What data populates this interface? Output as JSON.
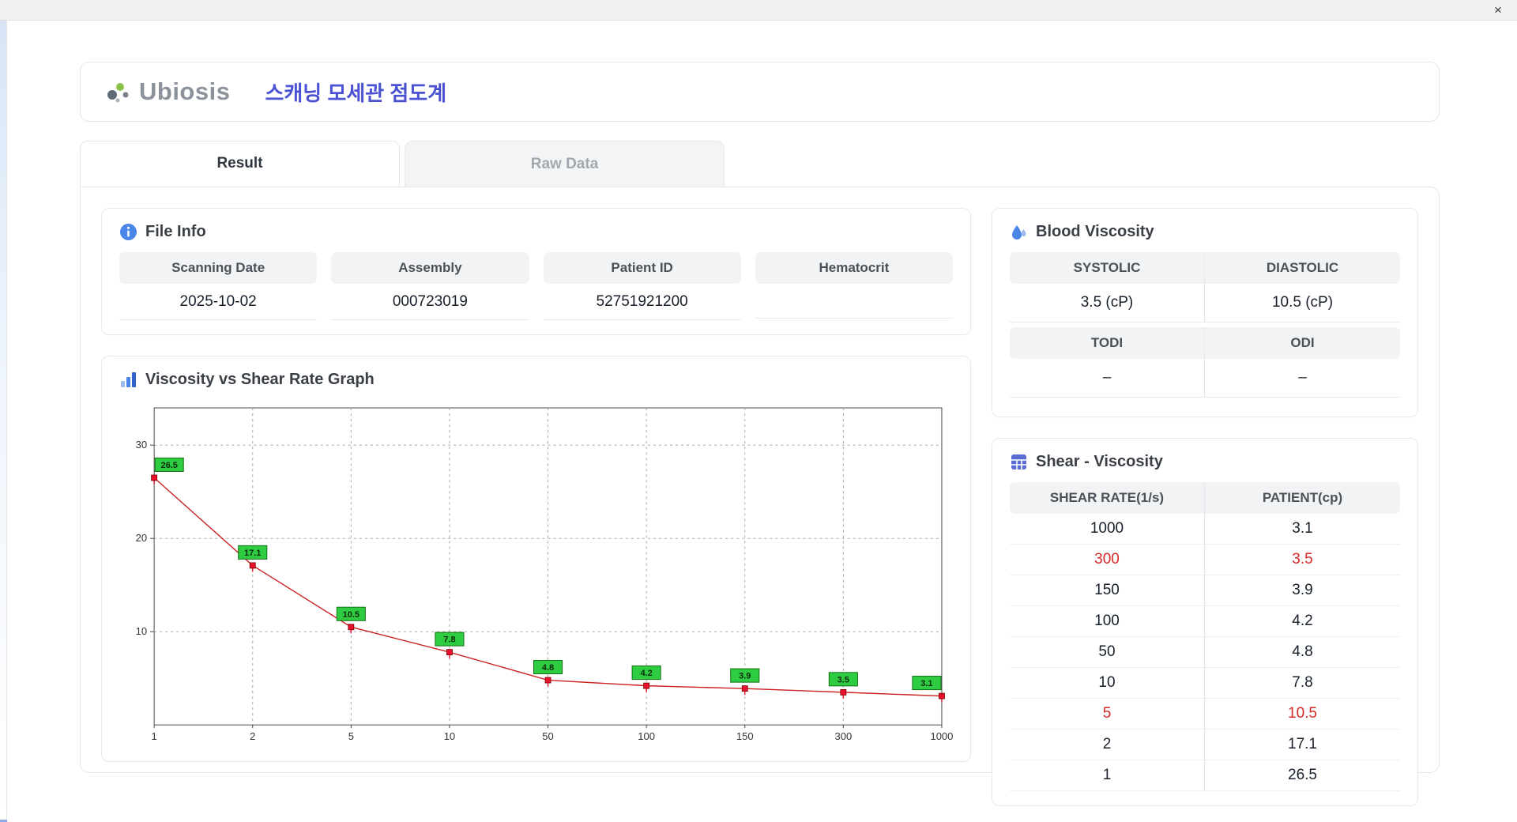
{
  "window": {
    "close_label": "×"
  },
  "header": {
    "logo_text": "Ubiosis",
    "title": "스캐닝 모세관 점도계"
  },
  "tabs": [
    {
      "label": "Result",
      "active": true
    },
    {
      "label": "Raw Data",
      "active": false
    }
  ],
  "file_info": {
    "title": "File Info",
    "fields": [
      {
        "label": "Scanning Date",
        "value": "2025-10-02"
      },
      {
        "label": "Assembly",
        "value": "000723019"
      },
      {
        "label": "Patient ID",
        "value": "52751921200"
      },
      {
        "label": "Hematocrit",
        "value": ""
      }
    ]
  },
  "graph_section": {
    "title": "Viscosity vs Shear Rate Graph"
  },
  "blood_viscosity": {
    "title": "Blood Viscosity",
    "groups": [
      {
        "headers": [
          "SYSTOLIC",
          "DIASTOLIC"
        ],
        "values": [
          "3.5 (cP)",
          "10.5 (cP)"
        ]
      },
      {
        "headers": [
          "TODI",
          "ODI"
        ],
        "values": [
          "–",
          "–"
        ]
      }
    ]
  },
  "shear_viscosity": {
    "title": "Shear - Viscosity",
    "headers": [
      "SHEAR RATE(1/s)",
      "PATIENT(cp)"
    ],
    "rows": [
      {
        "shear": "1000",
        "patient": "3.1",
        "highlight": false
      },
      {
        "shear": "300",
        "patient": "3.5",
        "highlight": true
      },
      {
        "shear": "150",
        "patient": "3.9",
        "highlight": false
      },
      {
        "shear": "100",
        "patient": "4.2",
        "highlight": false
      },
      {
        "shear": "50",
        "patient": "4.8",
        "highlight": false
      },
      {
        "shear": "10",
        "patient": "7.8",
        "highlight": false
      },
      {
        "shear": "5",
        "patient": "10.5",
        "highlight": true
      },
      {
        "shear": "2",
        "patient": "17.1",
        "highlight": false
      },
      {
        "shear": "1",
        "patient": "26.5",
        "highlight": false
      }
    ]
  },
  "chart_data": {
    "type": "line",
    "title": "Viscosity vs Shear Rate Graph",
    "xlabel": "",
    "ylabel": "",
    "x": [
      "1",
      "2",
      "5",
      "10",
      "50",
      "100",
      "150",
      "300",
      "1000"
    ],
    "values": [
      26.5,
      17.1,
      10.5,
      7.8,
      4.8,
      4.2,
      3.9,
      3.5,
      3.1
    ],
    "yticks": [
      10,
      20,
      30
    ],
    "ylim": [
      0,
      34
    ],
    "x_scale": "categorical",
    "grid": "dashed",
    "legend": "none",
    "line_color": "#cc2222",
    "marker_color": "#e8112d",
    "marker_edge": "#7a0000",
    "label_bg": "#2ecc40",
    "label_edge": "#157015"
  },
  "colors": {
    "title_blue": "#4b51d3",
    "accent_blue": "#4a86e8",
    "icon_purple": "#5b6bd5",
    "highlight_red": "#d62828",
    "header_gray": "#f1f3f5",
    "logo_gray": "#8b929c",
    "logo_green": "#8bc34a"
  }
}
